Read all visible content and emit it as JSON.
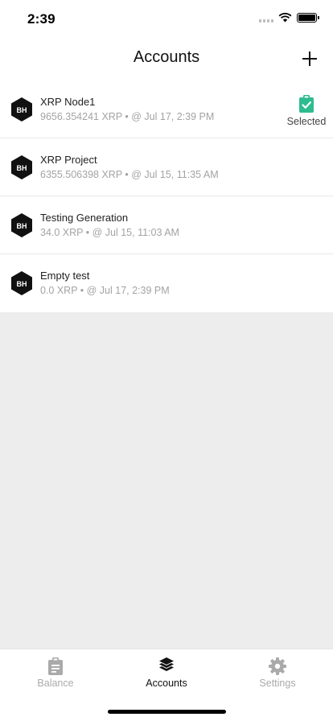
{
  "status_bar": {
    "time": "2:39"
  },
  "header": {
    "title": "Accounts",
    "add_icon": "plus-icon"
  },
  "accounts": [
    {
      "name": "XRP Node1",
      "meta": "9656.354241 XRP • @ Jul 17, 2:39 PM",
      "selected": true,
      "selected_label": "Selected"
    },
    {
      "name": "XRP Project",
      "meta": "6355.506398 XRP • @ Jul 15, 11:35 AM",
      "selected": false
    },
    {
      "name": "Testing Generation",
      "meta": "34.0 XRP • @ Jul 15, 11:03 AM",
      "selected": false
    },
    {
      "name": "Empty test",
      "meta": "0.0 XRP • @ Jul 17, 2:39 PM",
      "selected": false
    }
  ],
  "logo_text": "BH",
  "colors": {
    "accent": "#2ebc8f",
    "inactive": "#aaaaaa",
    "background": "#ededed"
  },
  "tabs": [
    {
      "label": "Balance",
      "icon": "clipboard-icon",
      "active": false
    },
    {
      "label": "Accounts",
      "icon": "layers-icon",
      "active": true
    },
    {
      "label": "Settings",
      "icon": "gear-icon",
      "active": false
    }
  ]
}
